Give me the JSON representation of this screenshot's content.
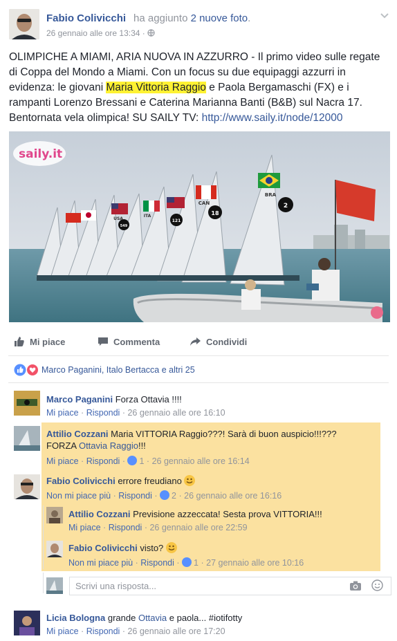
{
  "post": {
    "author": "Fabio Colivicchi",
    "action_prefix": "ha aggiunto",
    "action_photos": "2 nuove foto",
    "action_suffix": ".",
    "time": "26 gennaio alle ore 13:34",
    "text_part1": "OLIMPICHE A MIAMI, ARIA NUOVA IN AZZURRO - Il primo video sulle regate di Coppa del Mondo a Miami. Con un focus su due equipaggi azzurri in evidenza: le giovani ",
    "text_highlight": "Maria Vittoria Raggio",
    "text_part2": " e Paola Bergamaschi (FX) e i rampanti Lorenzo Bressani e Caterina Marianna Banti (B&B) sul Nacra 17. Bentornata vela olimpica! SU SAILY TV: ",
    "link": "http://www.saily.it/node/12000",
    "photo_logo": "saily.it",
    "sail_labels": [
      "BRA",
      "2",
      "CAN",
      "18",
      "121",
      "ITA",
      "USA",
      "549"
    ]
  },
  "actions": {
    "like": "Mi piace",
    "comment": "Commenta",
    "share": "Condividi"
  },
  "reactions": {
    "text": "Marco Paganini, Italo Bertacca e altri 25"
  },
  "comments": [
    {
      "author": "Marco Paganini",
      "text": "Forza Ottavia !!!!",
      "like": "Mi piace",
      "reply": "Rispondi",
      "time": "26 gennaio alle ore 16:10"
    },
    {
      "author": "Attilio Cozzani",
      "text_a": "Maria VITTORIA Raggio???! Sarà di buon auspicio!!!??? FORZA ",
      "mention": "Ottavia Raggio",
      "text_b": "!!!",
      "like": "Mi piace",
      "reply": "Rispondi",
      "count": "1",
      "time": "26 gennaio alle ore 16:14"
    },
    {
      "author": "Fabio Colivicchi",
      "text": "errore freudiano",
      "like": "Non mi piace più",
      "reply": "Rispondi",
      "count": "2",
      "time": "26 gennaio alle ore 16:16",
      "replies": [
        {
          "author": "Attilio Cozzani",
          "text": "Previsione azzeccata! Sesta prova VITTORIA!!!",
          "like": "Mi piace",
          "reply": "Rispondi",
          "time": "26 gennaio alle ore 22:59"
        },
        {
          "author": "Fabio Colivicchi",
          "text": "visto?",
          "like": "Non mi piace più",
          "reply": "Rispondi",
          "count": "1",
          "time": "27 gennaio alle ore 10:16"
        }
      ]
    },
    {
      "author": "Licia Bologna",
      "text_a": "grande ",
      "mention": "Ottavia",
      "text_b": " e paola... #iotifotty",
      "like": "Mi piace",
      "reply": "Rispondi",
      "time": "26 gennaio alle ore 17:20"
    }
  ],
  "reply_input": {
    "placeholder": "Scrivi una risposta..."
  },
  "separator": "·",
  "colors": {
    "link": "#365899",
    "highlight": "#fff233",
    "comment_highlight": "#fbe1a0"
  }
}
